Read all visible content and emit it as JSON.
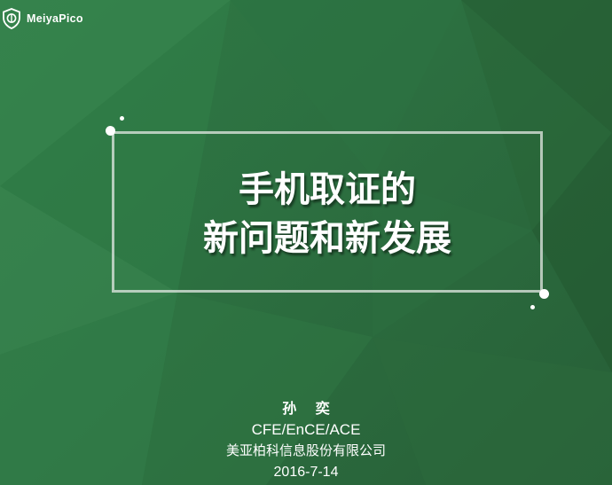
{
  "brand": {
    "name": "MeiyaPico"
  },
  "title": {
    "line1": "手机取证的",
    "line2": "新问题和新发展"
  },
  "presenter": {
    "name": "孙  奕",
    "credentials": "CFE/EnCE/ACE",
    "company": "美亚柏科信息股份有限公司",
    "date": "2016-7-14"
  },
  "colors": {
    "background": "#2c6f40",
    "frame": "#dce4de",
    "text": "#ffffff"
  }
}
